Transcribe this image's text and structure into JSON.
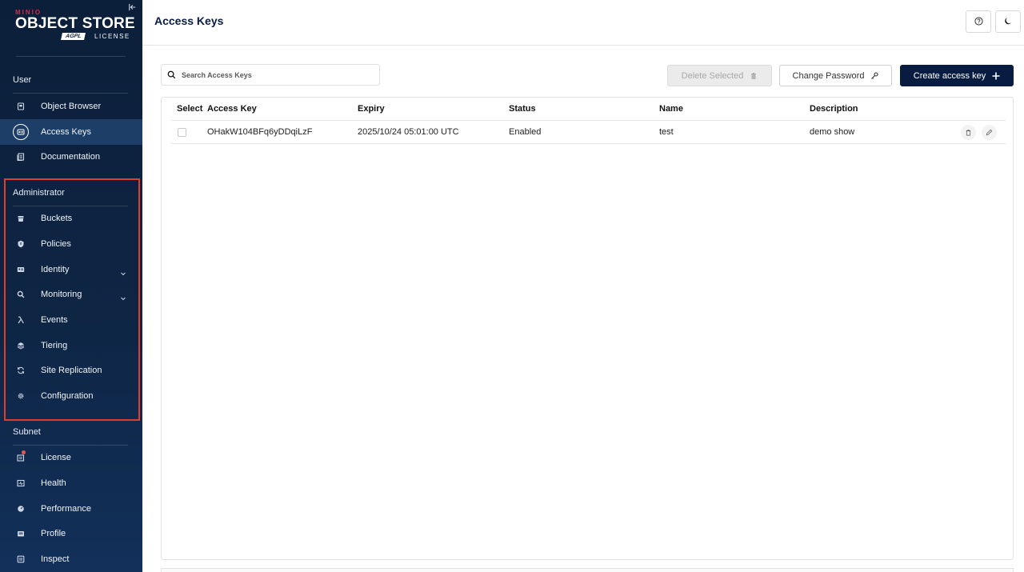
{
  "sidebar": {
    "logo": {
      "brand": "MINIO",
      "product": "OBJECT STORE",
      "license_badge": "AGPL",
      "license_text": "LICENSE"
    },
    "sections": {
      "user": {
        "title": "User",
        "items": [
          {
            "label": "Object Browser",
            "icon": "bucket-browser-icon"
          },
          {
            "label": "Access Keys",
            "icon": "access-keys-icon",
            "active": true
          },
          {
            "label": "Documentation",
            "icon": "documentation-icon"
          }
        ]
      },
      "administrator": {
        "title": "Administrator",
        "items": [
          {
            "label": "Buckets",
            "icon": "buckets-icon"
          },
          {
            "label": "Policies",
            "icon": "policies-icon"
          },
          {
            "label": "Identity",
            "icon": "identity-icon",
            "expandable": true
          },
          {
            "label": "Monitoring",
            "icon": "monitoring-icon",
            "expandable": true
          },
          {
            "label": "Events",
            "icon": "lambda-icon"
          },
          {
            "label": "Tiering",
            "icon": "tiering-icon"
          },
          {
            "label": "Site Replication",
            "icon": "replication-icon"
          },
          {
            "label": "Configuration",
            "icon": "gear-icon"
          }
        ]
      },
      "subnet": {
        "title": "Subnet",
        "items": [
          {
            "label": "License",
            "icon": "license-icon"
          },
          {
            "label": "Health",
            "icon": "health-icon"
          },
          {
            "label": "Performance",
            "icon": "performance-icon"
          },
          {
            "label": "Profile",
            "icon": "profile-icon"
          },
          {
            "label": "Inspect",
            "icon": "inspect-icon"
          }
        ]
      }
    }
  },
  "header": {
    "title": "Access Keys",
    "help_icon": "help-icon",
    "theme_icon": "moon-icon"
  },
  "toolbar": {
    "search_placeholder": "Search Access Keys",
    "delete_label": "Delete Selected",
    "change_password_label": "Change Password",
    "create_label": "Create access key"
  },
  "table": {
    "columns": [
      "Select",
      "Access Key",
      "Expiry",
      "Status",
      "Name",
      "Description"
    ],
    "rows": [
      {
        "access_key": "OHakW104BFq6yDDqiLzF",
        "expiry": "2025/10/24 05:01:00 UTC",
        "status": "Enabled",
        "name": "test",
        "description": "demo show"
      }
    ]
  },
  "colors": {
    "sidebar_bg": "#0c1f3a",
    "primary": "#081c42",
    "highlight_box": "#e23c2b"
  }
}
